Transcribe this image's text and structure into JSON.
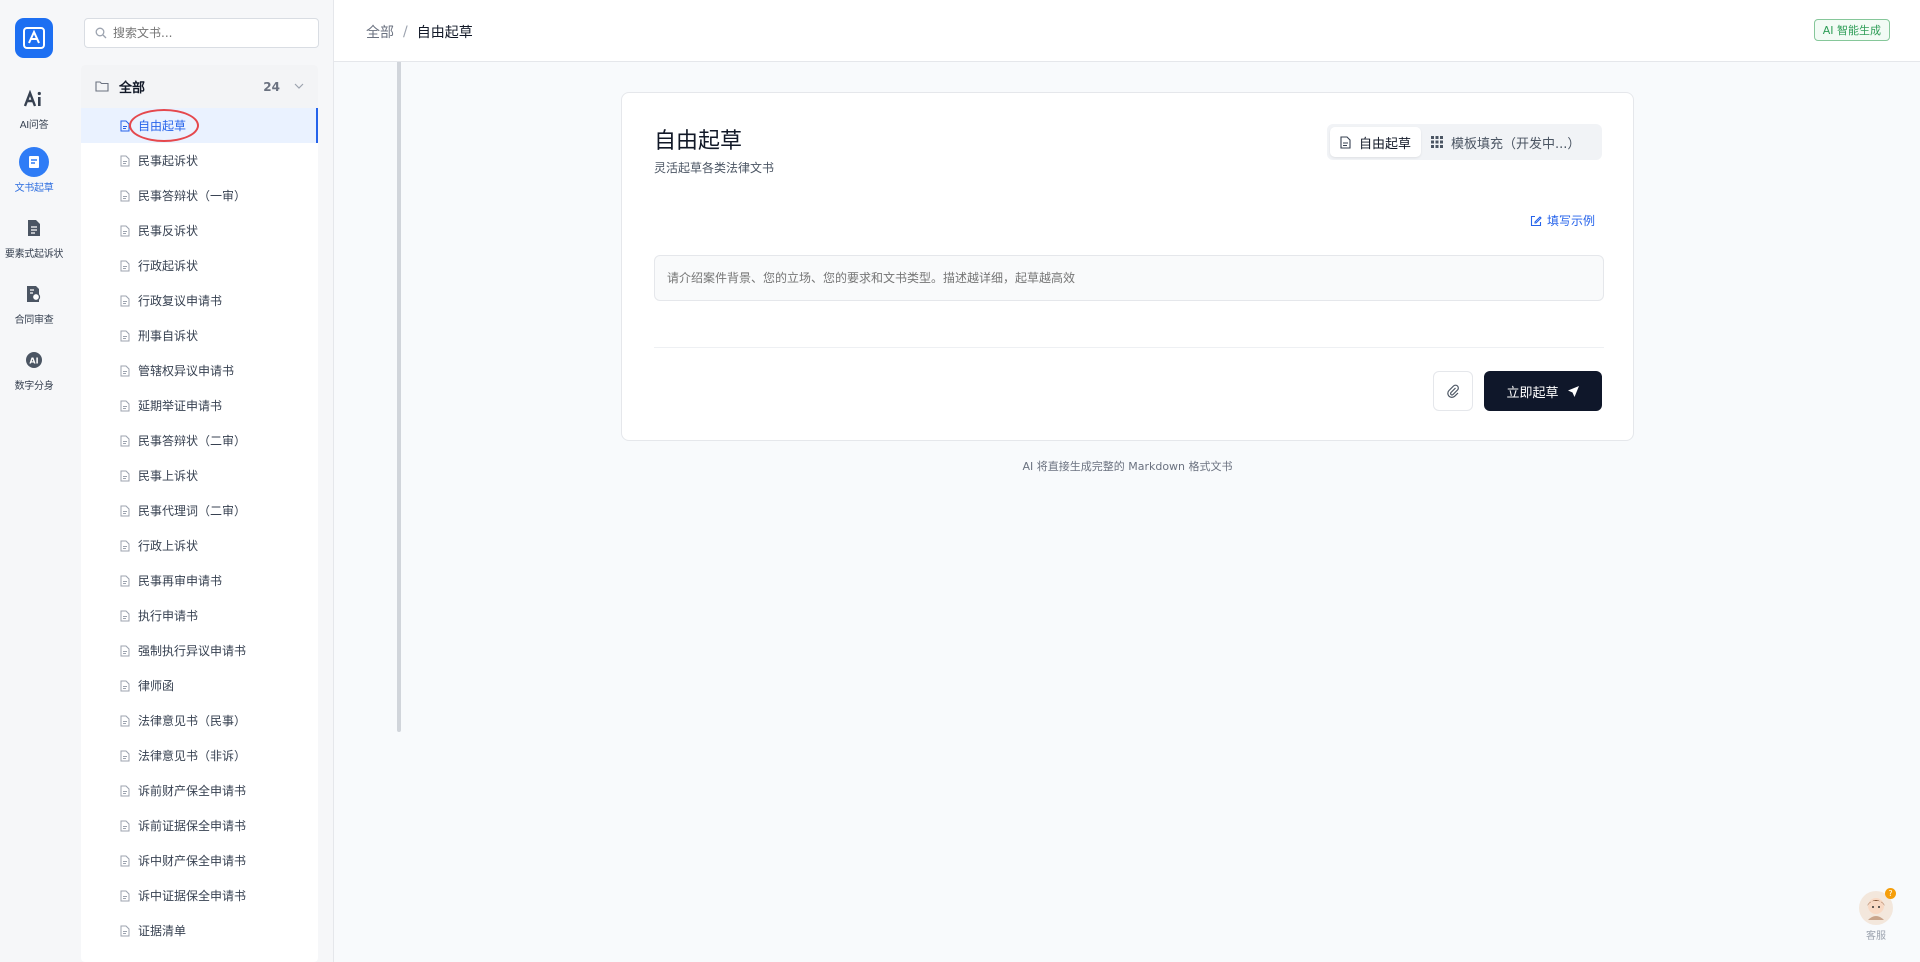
{
  "rail": {
    "items": [
      {
        "label": "AI问答",
        "icon": "ai-icon"
      },
      {
        "label": "文书起草",
        "icon": "document-draft-icon"
      },
      {
        "label": "要素式起诉状",
        "icon": "document-list-icon"
      },
      {
        "label": "合同审查",
        "icon": "contract-review-icon"
      },
      {
        "label": "数字分身",
        "icon": "digital-avatar-icon"
      }
    ]
  },
  "sidebar": {
    "search_placeholder": "搜索文书...",
    "group": {
      "name": "全部",
      "count": "24"
    },
    "items": [
      "自由起草",
      "民事起诉状",
      "民事答辩状（一审）",
      "民事反诉状",
      "行政起诉状",
      "行政复议申请书",
      "刑事自诉状",
      "管辖权异议申请书",
      "延期举证申请书",
      "民事答辩状（二审）",
      "民事上诉状",
      "民事代理词（二审）",
      "行政上诉状",
      "民事再审申请书",
      "执行申请书",
      "强制执行异议申请书",
      "律师函",
      "法律意见书（民事）",
      "法律意见书（非诉）",
      "诉前财产保全申请书",
      "诉前证据保全申请书",
      "诉中财产保全申请书",
      "诉中证据保全申请书",
      "证据清单"
    ]
  },
  "header": {
    "breadcrumb_root": "全部",
    "breadcrumb_sep": "/",
    "breadcrumb_current": "自由起草",
    "ai_badge": "AI 智能生成"
  },
  "main": {
    "title": "自由起草",
    "subtitle": "灵活起草各类法律文书",
    "mode_free": "自由起草",
    "mode_template": "模板填充（开发中...）",
    "example_link": "填写示例",
    "prompt_placeholder": "请介绍案件背景、您的立场、您的要求和文书类型。描述越详细，起草越高效",
    "submit_label": "立即起草",
    "footnote": "AI 将直接生成完整的 Markdown 格式文书"
  },
  "service": {
    "label": "客服",
    "badge": "?"
  },
  "colors": {
    "accent": "#2563eb",
    "primary_button": "#0f172a",
    "badge_green": "#2f9e58",
    "annotation_red": "#e5484d"
  }
}
